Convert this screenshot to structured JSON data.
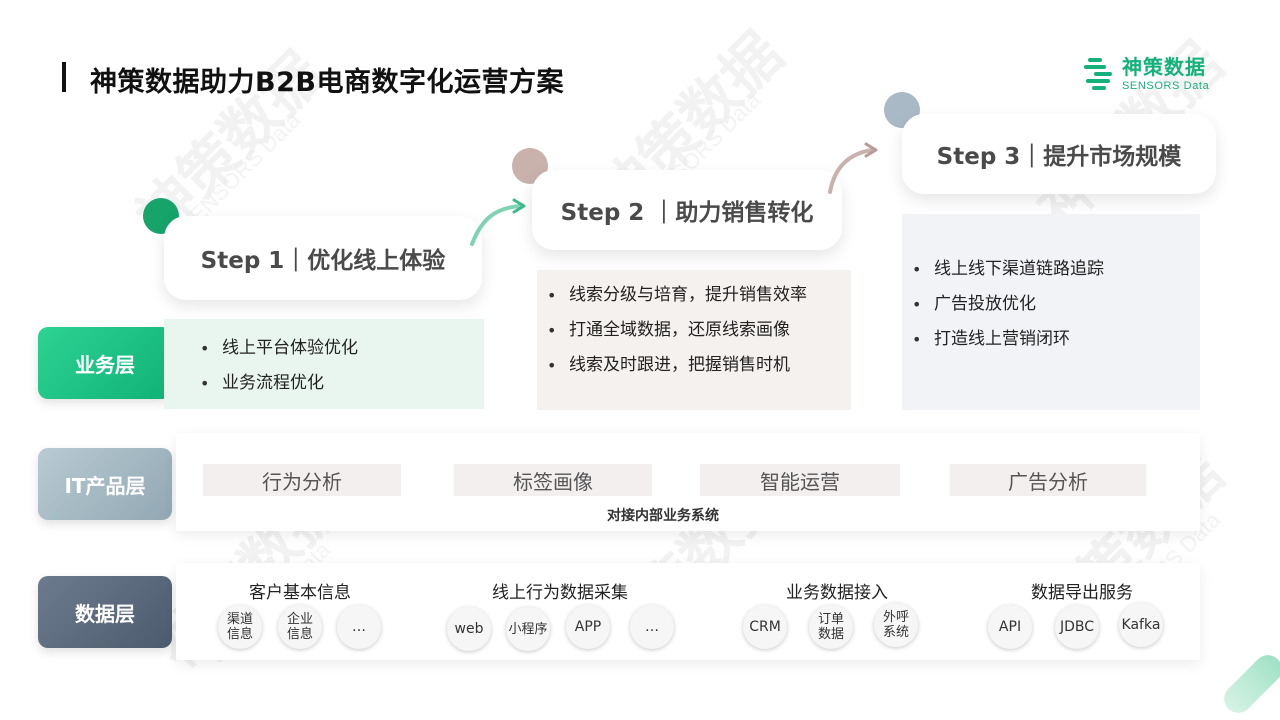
{
  "title": "神策数据助力B2B电商数字化运营方案",
  "logo": {
    "cn": "神策数据",
    "en": "SENSORS Data"
  },
  "watermark": {
    "cn": "神策数据",
    "en": "SENSORS Data"
  },
  "steps": [
    {
      "label": "Step 1｜优化线上体验",
      "dot_color": "#16a46a",
      "bullets": [
        "线上平台体验优化",
        "业务流程优化"
      ]
    },
    {
      "label": "Step 2 ｜助力销售转化",
      "dot_color": "#c9b2ab",
      "bullets": [
        "线索分级与培育，提升销售效率",
        "打通全域数据，还原线索画像",
        "线索及时跟进，把握销售时机"
      ]
    },
    {
      "label": "Step 3｜提升市场规模",
      "dot_color": "#aab9c6",
      "bullets": [
        "线上线下渠道链路追踪",
        "广告投放优化",
        "打造线上营销闭环"
      ]
    }
  ],
  "layers": {
    "business": {
      "label": "业务层",
      "color": "#1dc488"
    },
    "it": {
      "label": "IT产品层",
      "color": "#a7bac4",
      "chips": [
        "行为分析",
        "标签画像",
        "智能运营",
        "广告分析"
      ],
      "note": "对接内部业务系统"
    },
    "data": {
      "label": "数据层",
      "color": "#5d6c7e",
      "groups": [
        {
          "title": "客户基本信息",
          "items": [
            "渠道\n信息",
            "企业\n信息",
            "…"
          ]
        },
        {
          "title": "线上行为数据采集",
          "items": [
            "web",
            "小程序",
            "APP",
            "…"
          ]
        },
        {
          "title": "业务数据接入",
          "items": [
            "CRM",
            "订单\n数据",
            "外呼\n系统"
          ]
        },
        {
          "title": "数据导出服务",
          "items": [
            "API",
            "JDBC",
            "Kafka"
          ]
        }
      ]
    }
  }
}
